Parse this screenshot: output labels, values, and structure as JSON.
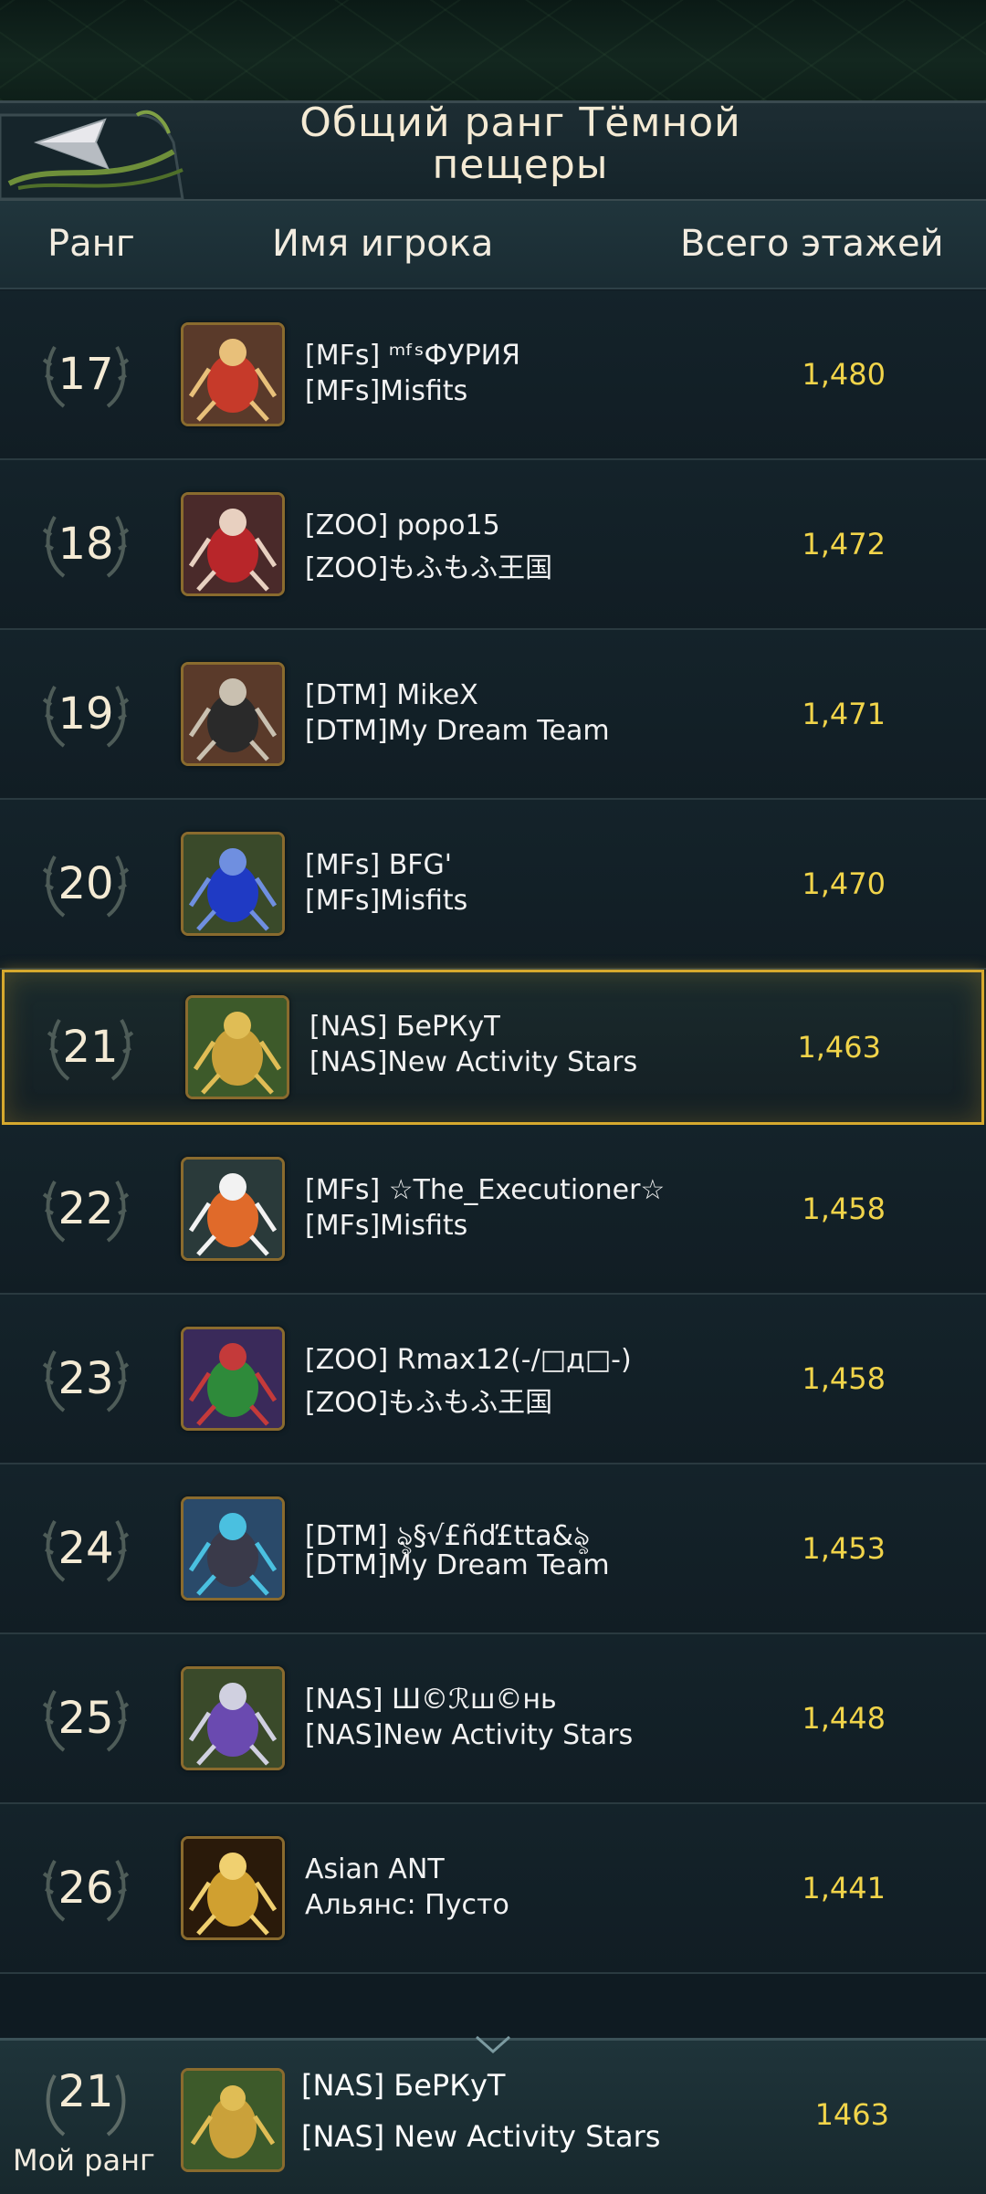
{
  "header": {
    "title_line1": "Общий ранг Тёмной",
    "title_line2": "пещеры"
  },
  "columns": {
    "rank": "Ранг",
    "player": "Имя игрока",
    "floors": "Всего этажей"
  },
  "rows": [
    {
      "rank": "17",
      "name": "[MFs] ᵐᶠˢФУРИЯ",
      "alliance": "[MFs]Misfits",
      "floors": "1,480",
      "avatar": "red-ant-avatar",
      "highlight": false
    },
    {
      "rank": "18",
      "name": "[ZOO] popo15",
      "alliance": "[ZOO]もふもふ王国",
      "floors": "1,472",
      "avatar": "crimson-ant-avatar",
      "highlight": false
    },
    {
      "rank": "19",
      "name": "[DTM] MikeX",
      "alliance": "[DTM]My Dream Team",
      "floors": "1,471",
      "avatar": "dark-beetle-avatar",
      "highlight": false
    },
    {
      "rank": "20",
      "name": "[MFs] BFG'",
      "alliance": "[MFs]Misfits",
      "floors": "1,470",
      "avatar": "blue-ant-avatar",
      "highlight": false
    },
    {
      "rank": "21",
      "name": "[NAS] БеРКуТ",
      "alliance": "[NAS]New Activity Stars",
      "floors": "1,463",
      "avatar": "golden-ant-avatar",
      "highlight": true
    },
    {
      "rank": "22",
      "name": "[MFs] ☆The_Executioner☆",
      "alliance": "[MFs]Misfits",
      "floors": "1,458",
      "avatar": "orange-mech-avatar",
      "highlight": false
    },
    {
      "rank": "23",
      "name": "[ZOO] Rmax12(-/□д□-)",
      "alliance": "[ZOO]もふもふ王国",
      "floors": "1,458",
      "avatar": "green-ant-avatar",
      "highlight": false
    },
    {
      "rank": "24",
      "name": "[DTM] ৡ§√£ñď£tta&ৡ",
      "alliance": "[DTM]My Dream Team",
      "floors": "1,453",
      "avatar": "armored-dragon-avatar",
      "highlight": false
    },
    {
      "rank": "25",
      "name": "[NAS] Ш©ℛш©нь",
      "alliance": "[NAS]New Activity Stars",
      "floors": "1,448",
      "avatar": "purple-ant-avatar",
      "highlight": false
    },
    {
      "rank": "26",
      "name": "Asian ANT",
      "alliance": "Альянс: Пусто",
      "floors": "1,441",
      "avatar": "gold-knight-avatar",
      "highlight": false
    }
  ],
  "my_rank": {
    "rank": "21",
    "label": "Мой ранг",
    "name": "[NAS] БеРКуТ",
    "alliance": "[NAS] New Activity Stars",
    "floors": "1463"
  },
  "colors": {
    "accent_gold": "#f1d44a",
    "highlight_border": "#d6a92e",
    "background": "#0f1b22"
  }
}
